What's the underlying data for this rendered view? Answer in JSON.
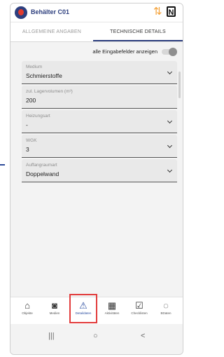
{
  "header": {
    "title": "Behälter C01"
  },
  "tabs": [
    {
      "label": "ALLGEMEINE ANGABEN"
    },
    {
      "label": "TECHNISCHE DETAILS"
    }
  ],
  "toggle": {
    "label": "alle Eingabefelder anzeigen",
    "enabled": false
  },
  "fields": [
    {
      "label": "Medium",
      "value": "Schmierstoffe"
    },
    {
      "label": "zul. Lagervolumen (m³)",
      "value": "200"
    },
    {
      "label": "Heizungsart",
      "value": "-"
    },
    {
      "label": "WGK",
      "value": "3"
    },
    {
      "label": "Auffangraumart",
      "value": "Doppelwand"
    }
  ],
  "bottom_nav": [
    {
      "label": "Objekte",
      "icon": "home-icon"
    },
    {
      "label": "Medien",
      "icon": "camera-icon"
    },
    {
      "label": "Detaildaten",
      "icon": "warning-icon"
    },
    {
      "label": "Aktivitäten",
      "icon": "calendar-icon"
    },
    {
      "label": "Checklisten",
      "icon": "checklist-icon"
    },
    {
      "label": "BDaten",
      "icon": "sync-circle-icon"
    }
  ],
  "system_nav": {
    "recents": "|||",
    "home": "○",
    "back": "<"
  },
  "colors": {
    "brand": "#2d3f7e",
    "accent": "#2d4fa1",
    "highlight": "#e23c3c"
  }
}
